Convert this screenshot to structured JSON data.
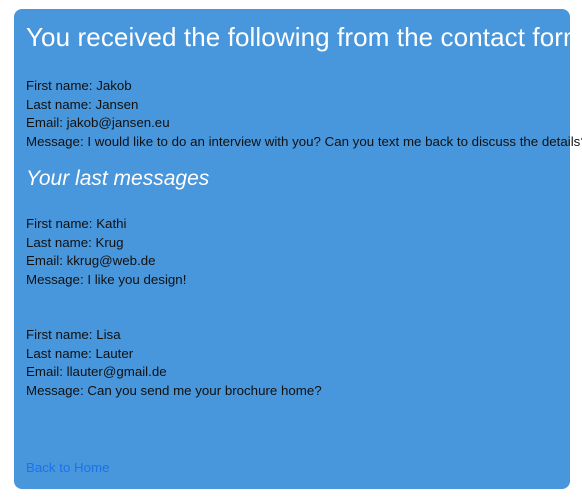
{
  "page": {
    "title": "You received the following from the contact form:",
    "received": {
      "first_name": "First name: Jakob",
      "last_name": "Last name: Jansen",
      "email": "Email: jakob@jansen.eu",
      "message": "Message: I would like to do an interview with you? Can you text me back to discuss the details?"
    },
    "last_messages_heading": "Your last messages",
    "last_messages": [
      {
        "first_name": "First name: Kathi",
        "last_name": "Last name: Krug",
        "email": "Email: kkrug@web.de",
        "message": "Message: I like you design!"
      },
      {
        "first_name": "First name: Lisa",
        "last_name": "Last name: Lauter",
        "email": "Email: llauter@gmail.de",
        "message": "Message: Can you send me your brochure home?"
      }
    ],
    "back_link": "Back to Home"
  },
  "colors": {
    "card_background": "#4896db",
    "heading_text": "#ffffff",
    "body_text": "#111111",
    "link": "#1a73e8"
  }
}
